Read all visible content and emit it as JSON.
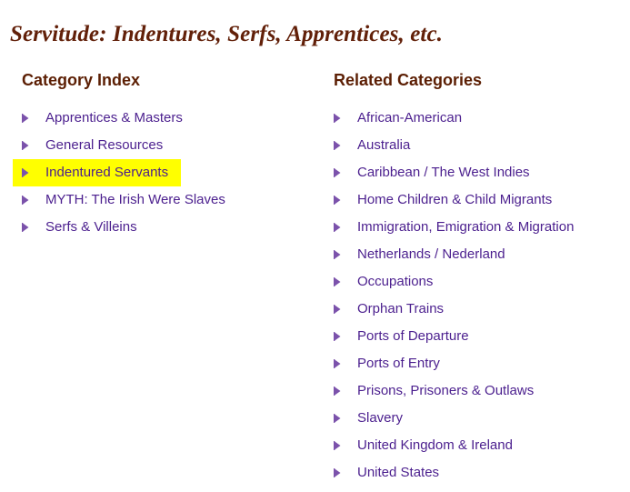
{
  "page": {
    "title": "Servitude: Indentures, Serfs, Apprentices, etc.",
    "background_color": "#ffffff",
    "title_color": "#622009",
    "heading_color": "#5c1f04",
    "link_color": "#4b1f8e",
    "highlight_color": "#ffff00",
    "bullet_color": "#7b52ab",
    "bullet_icon": "chevron-right-icon"
  },
  "columns": {
    "left": {
      "heading": "Category Index",
      "items": [
        {
          "label": "Apprentices & Masters",
          "highlighted": false
        },
        {
          "label": "General Resources",
          "highlighted": false
        },
        {
          "label": "Indentured Servants",
          "highlighted": true
        },
        {
          "label": "MYTH: The Irish Were Slaves",
          "highlighted": false
        },
        {
          "label": "Serfs & Villeins",
          "highlighted": false
        }
      ]
    },
    "right": {
      "heading": "Related Categories",
      "items": [
        {
          "label": "African-American",
          "highlighted": false
        },
        {
          "label": "Australia",
          "highlighted": false
        },
        {
          "label": "Caribbean / The West Indies",
          "highlighted": false
        },
        {
          "label": "Home Children & Child Migrants",
          "highlighted": false
        },
        {
          "label": "Immigration, Emigration & Migration",
          "highlighted": false
        },
        {
          "label": "Netherlands / Nederland",
          "highlighted": false
        },
        {
          "label": "Occupations",
          "highlighted": false
        },
        {
          "label": "Orphan Trains",
          "highlighted": false
        },
        {
          "label": "Ports of Departure",
          "highlighted": false
        },
        {
          "label": "Ports of Entry",
          "highlighted": false
        },
        {
          "label": "Prisons, Prisoners & Outlaws",
          "highlighted": false
        },
        {
          "label": "Slavery",
          "highlighted": false
        },
        {
          "label": "United Kingdom & Ireland",
          "highlighted": false
        },
        {
          "label": "United States",
          "highlighted": false
        }
      ]
    }
  }
}
